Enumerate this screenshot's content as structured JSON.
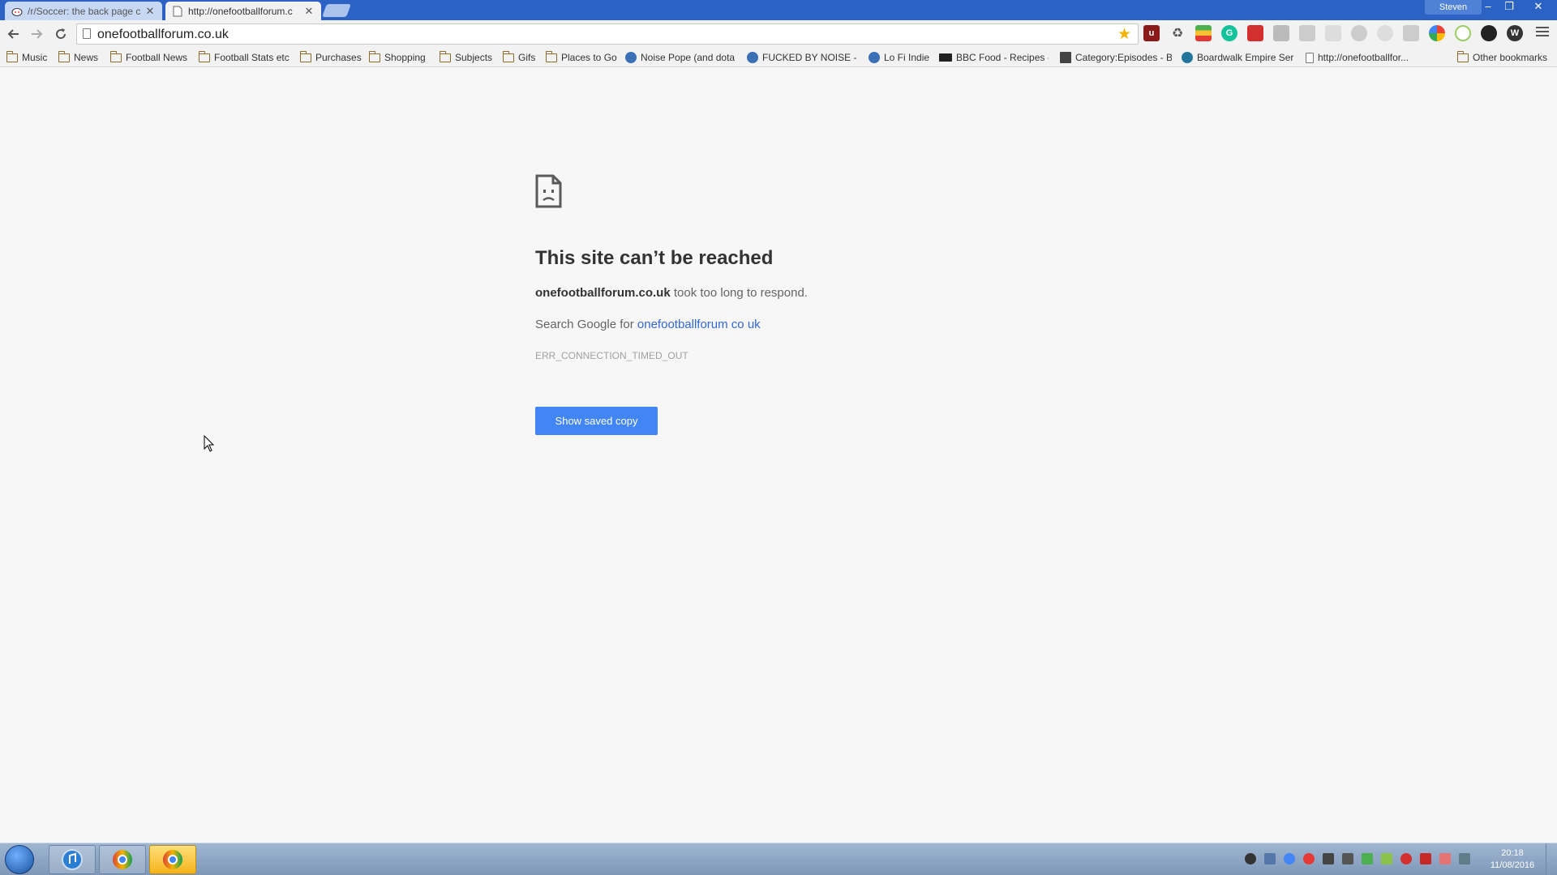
{
  "tabs": [
    {
      "title": "/r/Soccer: the back page c",
      "active": false
    },
    {
      "title": "http://onefootballforum.c",
      "active": true
    }
  ],
  "profile_name": "Steven",
  "window_controls": {
    "minimize": "–",
    "restore": "❐",
    "close": "✕"
  },
  "address_bar": {
    "url": "onefootballforum.co.uk"
  },
  "bookmarks": [
    {
      "label": "Music",
      "type": "folder"
    },
    {
      "label": "News",
      "type": "folder"
    },
    {
      "label": "Football News",
      "type": "folder"
    },
    {
      "label": "Football Stats etc",
      "type": "folder"
    },
    {
      "label": "Purchases",
      "type": "folder"
    },
    {
      "label": "Shopping",
      "type": "folder"
    },
    {
      "label": "Subjects",
      "type": "folder"
    },
    {
      "label": "Gifs",
      "type": "folder"
    },
    {
      "label": "Places to Go",
      "type": "folder"
    },
    {
      "label": "Noise Pope (and dota",
      "type": "link"
    },
    {
      "label": "FUCKED BY NOISE - R",
      "type": "link"
    },
    {
      "label": "Lo Fi Indie",
      "type": "link"
    },
    {
      "label": "BBC Food - Recipes -",
      "type": "link"
    },
    {
      "label": "Category:Episodes - B",
      "type": "link"
    },
    {
      "label": "Boardwalk Empire Ser",
      "type": "link"
    },
    {
      "label": "http://onefootballfor...",
      "type": "page"
    }
  ],
  "other_bookmarks": "Other bookmarks",
  "error_page": {
    "title": "This site can’t be reached",
    "host": "onefootballforum.co.uk",
    "message": " took too long to respond.",
    "search_prefix": "Search Google for ",
    "search_link": "onefootballforum co uk",
    "error_code": "ERR_CONNECTION_TIMED_OUT",
    "button_label": "Show saved copy"
  },
  "clock": {
    "time": "20:18",
    "date": "11/08/2016"
  },
  "colors": {
    "accent": "#4285f4",
    "link": "#3367d6",
    "titlebar": "#2b62c4"
  }
}
